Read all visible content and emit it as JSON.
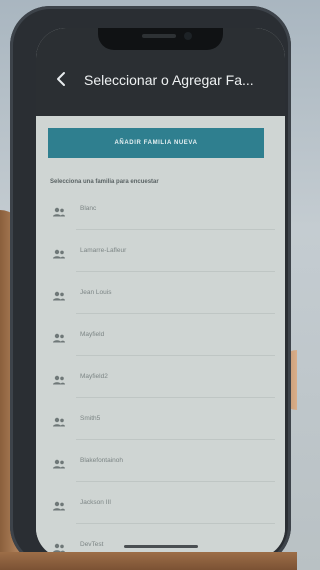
{
  "appbar": {
    "title": "Seleccionar o Agregar Fa...",
    "back_icon": "arrow-left-icon"
  },
  "main": {
    "add_button_label": "AÑADIR FAMILIA NUEVA",
    "instruction": "Selecciona una familia para encuestar",
    "families": [
      {
        "name": "Blanc"
      },
      {
        "name": "Lamarre-Lafleur"
      },
      {
        "name": "Jean Louis"
      },
      {
        "name": "Mayfield"
      },
      {
        "name": "Mayfield2"
      },
      {
        "name": "Smith5"
      },
      {
        "name": "Blakefontainoh"
      },
      {
        "name": "Jackson III"
      },
      {
        "name": "DevTest"
      }
    ]
  },
  "colors": {
    "appbar_bg": "#2b2f33",
    "accent": "#2f7f8f",
    "list_bg": "#cfd5d3"
  }
}
